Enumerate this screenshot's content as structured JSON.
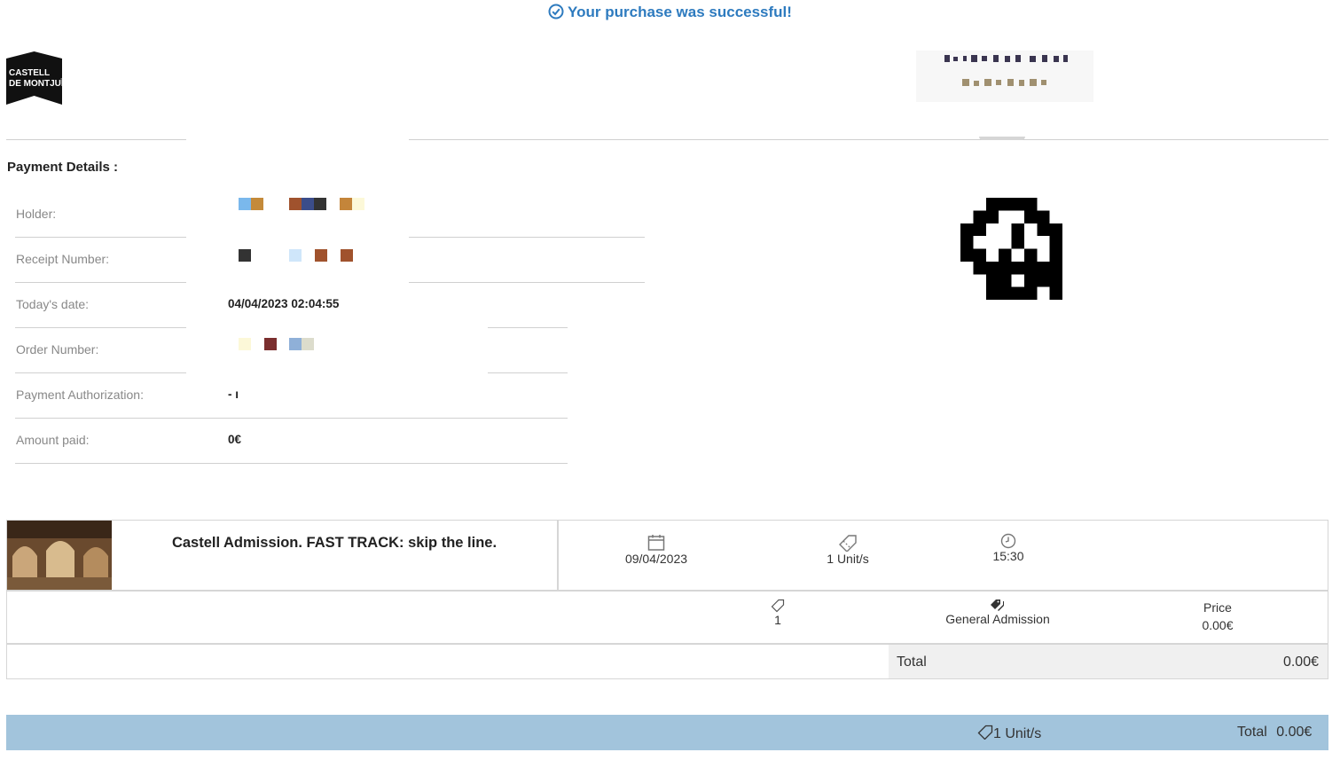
{
  "banner": {
    "message": "Your purchase was successful!",
    "icon": "check-circle-icon",
    "color": "#2e7bbf"
  },
  "brand": {
    "logo_line1": "CASTELL",
    "logo_line2": "DE MONTJUÏC"
  },
  "payment": {
    "title": "Payment Details :",
    "rows": [
      {
        "label": "Holder:",
        "value": ""
      },
      {
        "label": "Receipt Number:",
        "value": ""
      },
      {
        "label": "Today's date:",
        "value": "04/04/2023 02:04:55"
      },
      {
        "label": "Order Number:",
        "value": ""
      },
      {
        "label": "Payment Authorization:",
        "value": "- ı"
      },
      {
        "label": "Amount paid:",
        "value": "0€"
      }
    ]
  },
  "product": {
    "title": "Castell Admission. FAST TRACK: skip the line.",
    "date": "09/04/2023",
    "units": "1 Unit/s",
    "time": "15:30",
    "ticket_qty": "1",
    "ticket_type": "General Admission",
    "price_label": "Price",
    "price_value": "0.00€",
    "total_label": "Total",
    "total_value": "0.00€"
  },
  "footer": {
    "units": "1 Unit/s",
    "total_label": "Total",
    "total_value": "0.00€",
    "bar_color": "#a2c4dc"
  }
}
